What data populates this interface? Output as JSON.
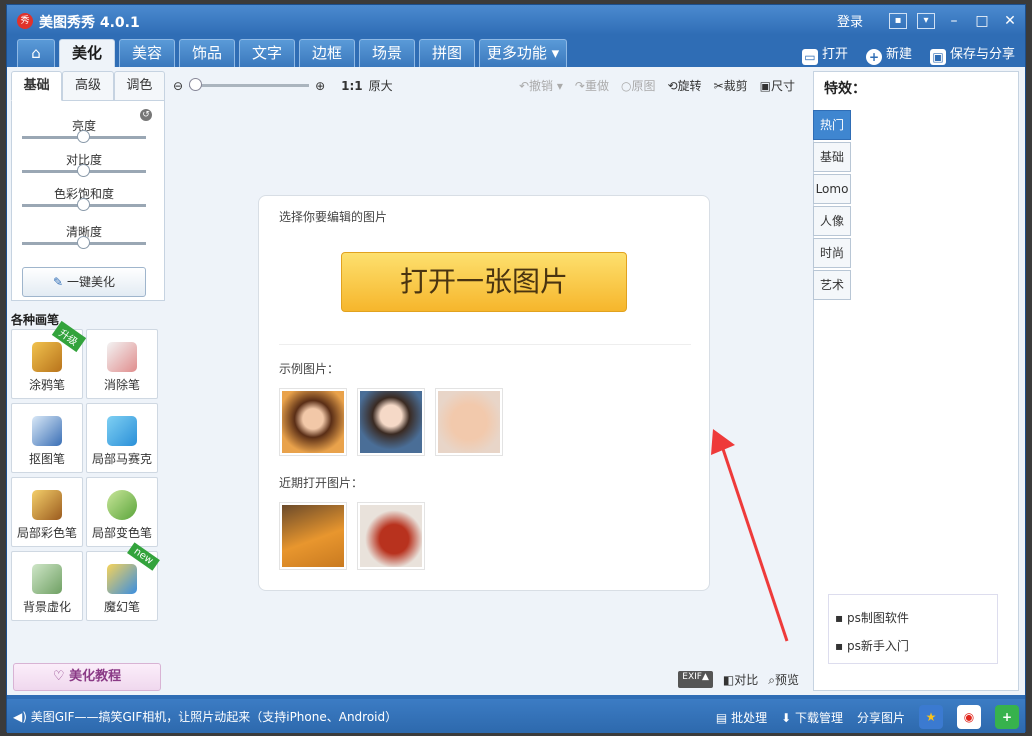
{
  "titlebar": {
    "title": "美图秀秀 4.0.1",
    "logo_text": "秀",
    "login": "登录"
  },
  "tabs": [
    "美化",
    "美容",
    "饰品",
    "文字",
    "边框",
    "场景",
    "拼图",
    "更多功能"
  ],
  "active_tab": "美化",
  "actions": {
    "open": "打开",
    "new": "新建",
    "save_share": "保存与分享"
  },
  "left": {
    "subtabs": [
      "基础",
      "高级",
      "调色"
    ],
    "sliders": [
      "亮度",
      "对比度",
      "色彩饱和度",
      "清晰度"
    ],
    "onekey": "一键美化",
    "brush_title": "各种画笔",
    "brushes": [
      {
        "label": "涂鸦笔",
        "badge": "升级"
      },
      {
        "label": "消除笔"
      },
      {
        "label": "抠图笔"
      },
      {
        "label": "局部马赛克"
      },
      {
        "label": "局部彩色笔"
      },
      {
        "label": "局部变色笔"
      },
      {
        "label": "背景虚化"
      },
      {
        "label": "魔幻笔",
        "badge": "new"
      }
    ],
    "tutorial": "美化教程"
  },
  "toolbar": {
    "zoom_ratio": "1:1",
    "zoom_label": "原大",
    "undo": "撤销",
    "redo": "重做",
    "original": "原图",
    "rotate": "旋转",
    "crop": "裁剪",
    "size": "尺寸"
  },
  "card": {
    "hint": "选择你要编辑的图片",
    "open_button": "打开一张图片",
    "examples": "示例图片：",
    "recent": "近期打开图片："
  },
  "view": {
    "exif": "EXIF▲",
    "compare": "对比",
    "preview": "预览"
  },
  "right": {
    "title": "特效：",
    "tabs": [
      "热门",
      "基础",
      "Lomo",
      "人像",
      "时尚",
      "艺术"
    ],
    "ad1": "ps制图软件",
    "ad2": "ps新手入门"
  },
  "status": {
    "marquee": "美图GIF——搞笑GIF相机，让照片动起来（支持iPhone、Android）",
    "batch": "批处理",
    "download": "下载管理",
    "share": "分享图片"
  }
}
